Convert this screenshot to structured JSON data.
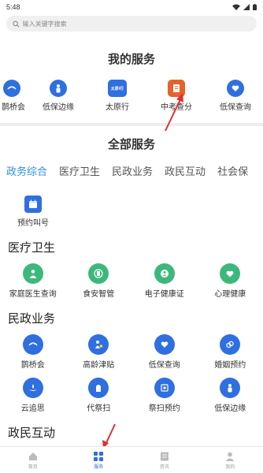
{
  "status": {
    "time": "5:48"
  },
  "search": {
    "placeholder": "输入关键字搜索"
  },
  "my_services": {
    "title": "我的服务",
    "items": [
      {
        "label": "鹊桥会",
        "icon": "magpie-bridge-icon"
      },
      {
        "label": "低保边缘",
        "icon": "person-family-icon"
      },
      {
        "label": "太原行",
        "icon": "taiyuan-xing-icon",
        "badge": "太原i行"
      },
      {
        "label": "中考查分",
        "icon": "score-query-icon"
      },
      {
        "label": "低保查询",
        "icon": "heart-hand-icon"
      }
    ]
  },
  "all_services": {
    "title": "全部服务",
    "tabs": [
      "政务综合",
      "医疗卫生",
      "民政业务",
      "政民互动",
      "社会保"
    ],
    "active_tab": "政务综合"
  },
  "gov_general": {
    "items": [
      {
        "label": "预约叫号",
        "icon": "calendar-icon"
      }
    ]
  },
  "medical": {
    "title": "医疗卫生",
    "items": [
      {
        "label": "家庭医生查询",
        "icon": "doctor-icon"
      },
      {
        "label": "食安智管",
        "icon": "food-safety-icon"
      },
      {
        "label": "电子健康证",
        "icon": "health-cert-icon"
      },
      {
        "label": "心理健康",
        "icon": "mental-health-icon"
      }
    ]
  },
  "civil": {
    "title": "民政业务",
    "items": [
      {
        "label": "鹊桥会",
        "icon": "magpie-bridge-icon"
      },
      {
        "label": "高龄津贴",
        "icon": "elderly-allowance-icon"
      },
      {
        "label": "低保查询",
        "icon": "heart-hand-icon"
      },
      {
        "label": "婚姻预约",
        "icon": "marriage-icon"
      },
      {
        "label": "云追思",
        "icon": "memorial-icon"
      },
      {
        "label": "代祭扫",
        "icon": "tomb-sweep-icon"
      },
      {
        "label": "祭扫预约",
        "icon": "sweep-booking-icon"
      },
      {
        "label": "低保边缘",
        "icon": "person-family-icon"
      }
    ]
  },
  "interaction": {
    "title": "政民互动"
  },
  "bottom_nav": [
    {
      "label": "首页",
      "icon": "home-icon"
    },
    {
      "label": "服务",
      "icon": "grid-icon"
    },
    {
      "label": "资讯",
      "icon": "news-icon"
    },
    {
      "label": "我的",
      "icon": "user-icon"
    }
  ],
  "colors": {
    "accent": "#2f8fdd",
    "icon_blue": "#2f6fe0",
    "icon_green": "#3db87c",
    "arrow": "#e03030"
  }
}
